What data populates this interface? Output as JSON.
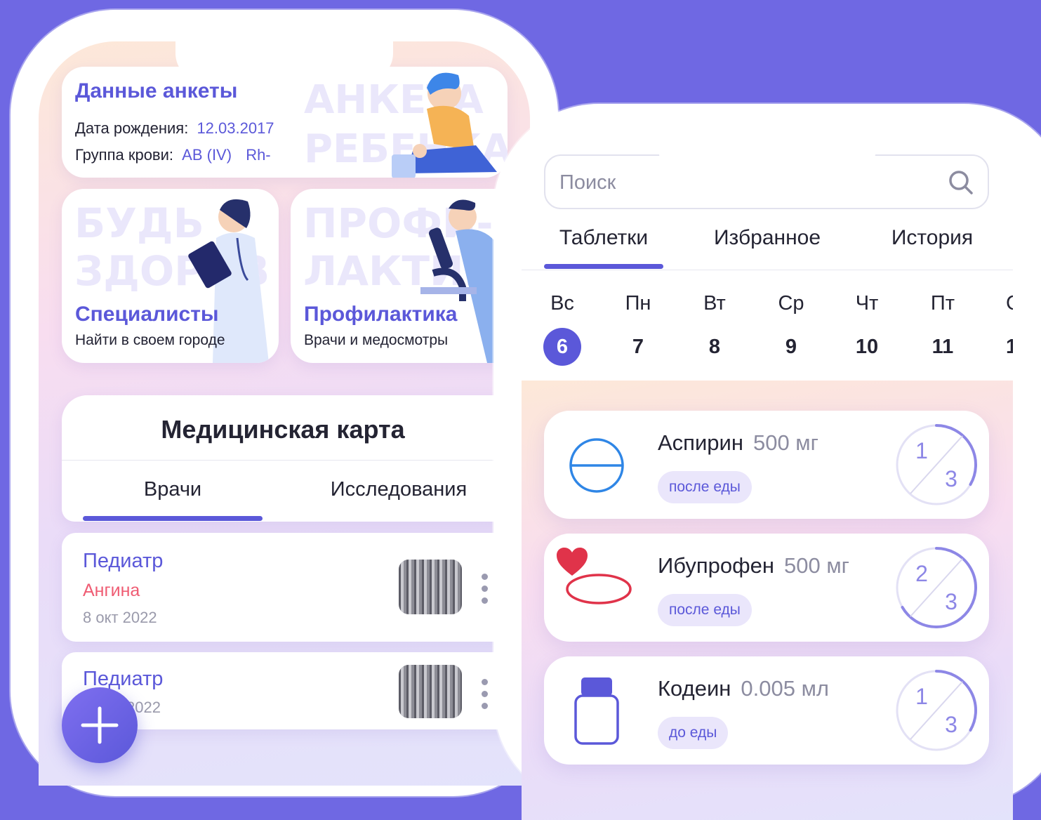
{
  "profile": {
    "title": "Данные анкеты",
    "birth_label": "Дата рождения:",
    "birth_value": "12.03.2017",
    "blood_label": "Группа крови:",
    "blood_value": "AB (IV)",
    "rh_value": "Rh-",
    "ghost_line1": "АНКЕТА",
    "ghost_line2": "РЕБЕНКА"
  },
  "specialists": {
    "ghost_line1": "БУДЬ",
    "ghost_line2": "ЗДОРОВ",
    "title": "Специалисты",
    "subtitle": "Найти в своем городе"
  },
  "prevention": {
    "ghost_line1": "ПРОФИ-",
    "ghost_line2": "ЛАКТИКА",
    "title": "Профилактика",
    "subtitle": "Врачи и медосмотры"
  },
  "medcard": {
    "title": "Медицинская карта",
    "tabs": [
      "Врачи",
      "Исследования"
    ]
  },
  "visits": [
    {
      "doctor": "Педиатр",
      "diagnosis": "Ангина",
      "date": "8 окт 2022"
    },
    {
      "doctor": "Педиатр",
      "date": "2022"
    }
  ],
  "search": {
    "placeholder": "Поиск"
  },
  "pill_tabs": [
    "Таблетки",
    "Избранное",
    "История"
  ],
  "days": [
    {
      "name": "Вс",
      "num": "6",
      "selected": true
    },
    {
      "name": "Пн",
      "num": "7"
    },
    {
      "name": "Вт",
      "num": "8"
    },
    {
      "name": "Ср",
      "num": "9"
    },
    {
      "name": "Чт",
      "num": "10"
    },
    {
      "name": "Пт",
      "num": "11"
    },
    {
      "name": "С",
      "num": "1"
    }
  ],
  "pills": [
    {
      "name": "Аспирин",
      "dose": "500 мг",
      "note": "после еды",
      "taken": "1",
      "total": "3",
      "icon": "round-tablet-icon"
    },
    {
      "name": "Ибупрофен",
      "dose": "500 мг",
      "note": "после еды",
      "taken": "2",
      "total": "3",
      "icon": "oval-tablet-icon"
    },
    {
      "name": "Кодеин",
      "dose": "0.005 мл",
      "note": "до еды",
      "taken": "1",
      "total": "3",
      "icon": "bottle-icon"
    }
  ],
  "colors": {
    "accent": "#5b58d9",
    "background": "#6f68e3",
    "diagnosis": "#ef5c73",
    "aspirin_icon": "#2f86e6",
    "ibuprofen_icon": "#e0334a"
  }
}
